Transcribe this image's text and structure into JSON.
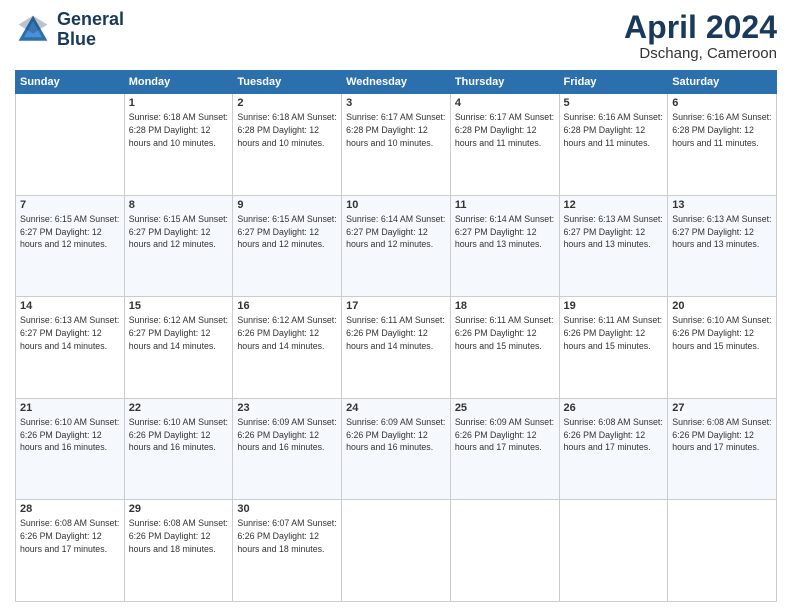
{
  "logo": {
    "line1": "General",
    "line2": "Blue"
  },
  "header": {
    "month_year": "April 2024",
    "location": "Dschang, Cameroon"
  },
  "weekdays": [
    "Sunday",
    "Monday",
    "Tuesday",
    "Wednesday",
    "Thursday",
    "Friday",
    "Saturday"
  ],
  "weeks": [
    [
      {
        "day": "",
        "info": ""
      },
      {
        "day": "1",
        "info": "Sunrise: 6:18 AM\nSunset: 6:28 PM\nDaylight: 12 hours\nand 10 minutes."
      },
      {
        "day": "2",
        "info": "Sunrise: 6:18 AM\nSunset: 6:28 PM\nDaylight: 12 hours\nand 10 minutes."
      },
      {
        "day": "3",
        "info": "Sunrise: 6:17 AM\nSunset: 6:28 PM\nDaylight: 12 hours\nand 10 minutes."
      },
      {
        "day": "4",
        "info": "Sunrise: 6:17 AM\nSunset: 6:28 PM\nDaylight: 12 hours\nand 11 minutes."
      },
      {
        "day": "5",
        "info": "Sunrise: 6:16 AM\nSunset: 6:28 PM\nDaylight: 12 hours\nand 11 minutes."
      },
      {
        "day": "6",
        "info": "Sunrise: 6:16 AM\nSunset: 6:28 PM\nDaylight: 12 hours\nand 11 minutes."
      }
    ],
    [
      {
        "day": "7",
        "info": "Sunrise: 6:15 AM\nSunset: 6:27 PM\nDaylight: 12 hours\nand 12 minutes."
      },
      {
        "day": "8",
        "info": "Sunrise: 6:15 AM\nSunset: 6:27 PM\nDaylight: 12 hours\nand 12 minutes."
      },
      {
        "day": "9",
        "info": "Sunrise: 6:15 AM\nSunset: 6:27 PM\nDaylight: 12 hours\nand 12 minutes."
      },
      {
        "day": "10",
        "info": "Sunrise: 6:14 AM\nSunset: 6:27 PM\nDaylight: 12 hours\nand 12 minutes."
      },
      {
        "day": "11",
        "info": "Sunrise: 6:14 AM\nSunset: 6:27 PM\nDaylight: 12 hours\nand 13 minutes."
      },
      {
        "day": "12",
        "info": "Sunrise: 6:13 AM\nSunset: 6:27 PM\nDaylight: 12 hours\nand 13 minutes."
      },
      {
        "day": "13",
        "info": "Sunrise: 6:13 AM\nSunset: 6:27 PM\nDaylight: 12 hours\nand 13 minutes."
      }
    ],
    [
      {
        "day": "14",
        "info": "Sunrise: 6:13 AM\nSunset: 6:27 PM\nDaylight: 12 hours\nand 14 minutes."
      },
      {
        "day": "15",
        "info": "Sunrise: 6:12 AM\nSunset: 6:27 PM\nDaylight: 12 hours\nand 14 minutes."
      },
      {
        "day": "16",
        "info": "Sunrise: 6:12 AM\nSunset: 6:26 PM\nDaylight: 12 hours\nand 14 minutes."
      },
      {
        "day": "17",
        "info": "Sunrise: 6:11 AM\nSunset: 6:26 PM\nDaylight: 12 hours\nand 14 minutes."
      },
      {
        "day": "18",
        "info": "Sunrise: 6:11 AM\nSunset: 6:26 PM\nDaylight: 12 hours\nand 15 minutes."
      },
      {
        "day": "19",
        "info": "Sunrise: 6:11 AM\nSunset: 6:26 PM\nDaylight: 12 hours\nand 15 minutes."
      },
      {
        "day": "20",
        "info": "Sunrise: 6:10 AM\nSunset: 6:26 PM\nDaylight: 12 hours\nand 15 minutes."
      }
    ],
    [
      {
        "day": "21",
        "info": "Sunrise: 6:10 AM\nSunset: 6:26 PM\nDaylight: 12 hours\nand 16 minutes."
      },
      {
        "day": "22",
        "info": "Sunrise: 6:10 AM\nSunset: 6:26 PM\nDaylight: 12 hours\nand 16 minutes."
      },
      {
        "day": "23",
        "info": "Sunrise: 6:09 AM\nSunset: 6:26 PM\nDaylight: 12 hours\nand 16 minutes."
      },
      {
        "day": "24",
        "info": "Sunrise: 6:09 AM\nSunset: 6:26 PM\nDaylight: 12 hours\nand 16 minutes."
      },
      {
        "day": "25",
        "info": "Sunrise: 6:09 AM\nSunset: 6:26 PM\nDaylight: 12 hours\nand 17 minutes."
      },
      {
        "day": "26",
        "info": "Sunrise: 6:08 AM\nSunset: 6:26 PM\nDaylight: 12 hours\nand 17 minutes."
      },
      {
        "day": "27",
        "info": "Sunrise: 6:08 AM\nSunset: 6:26 PM\nDaylight: 12 hours\nand 17 minutes."
      }
    ],
    [
      {
        "day": "28",
        "info": "Sunrise: 6:08 AM\nSunset: 6:26 PM\nDaylight: 12 hours\nand 17 minutes."
      },
      {
        "day": "29",
        "info": "Sunrise: 6:08 AM\nSunset: 6:26 PM\nDaylight: 12 hours\nand 18 minutes."
      },
      {
        "day": "30",
        "info": "Sunrise: 6:07 AM\nSunset: 6:26 PM\nDaylight: 12 hours\nand 18 minutes."
      },
      {
        "day": "",
        "info": ""
      },
      {
        "day": "",
        "info": ""
      },
      {
        "day": "",
        "info": ""
      },
      {
        "day": "",
        "info": ""
      }
    ]
  ]
}
